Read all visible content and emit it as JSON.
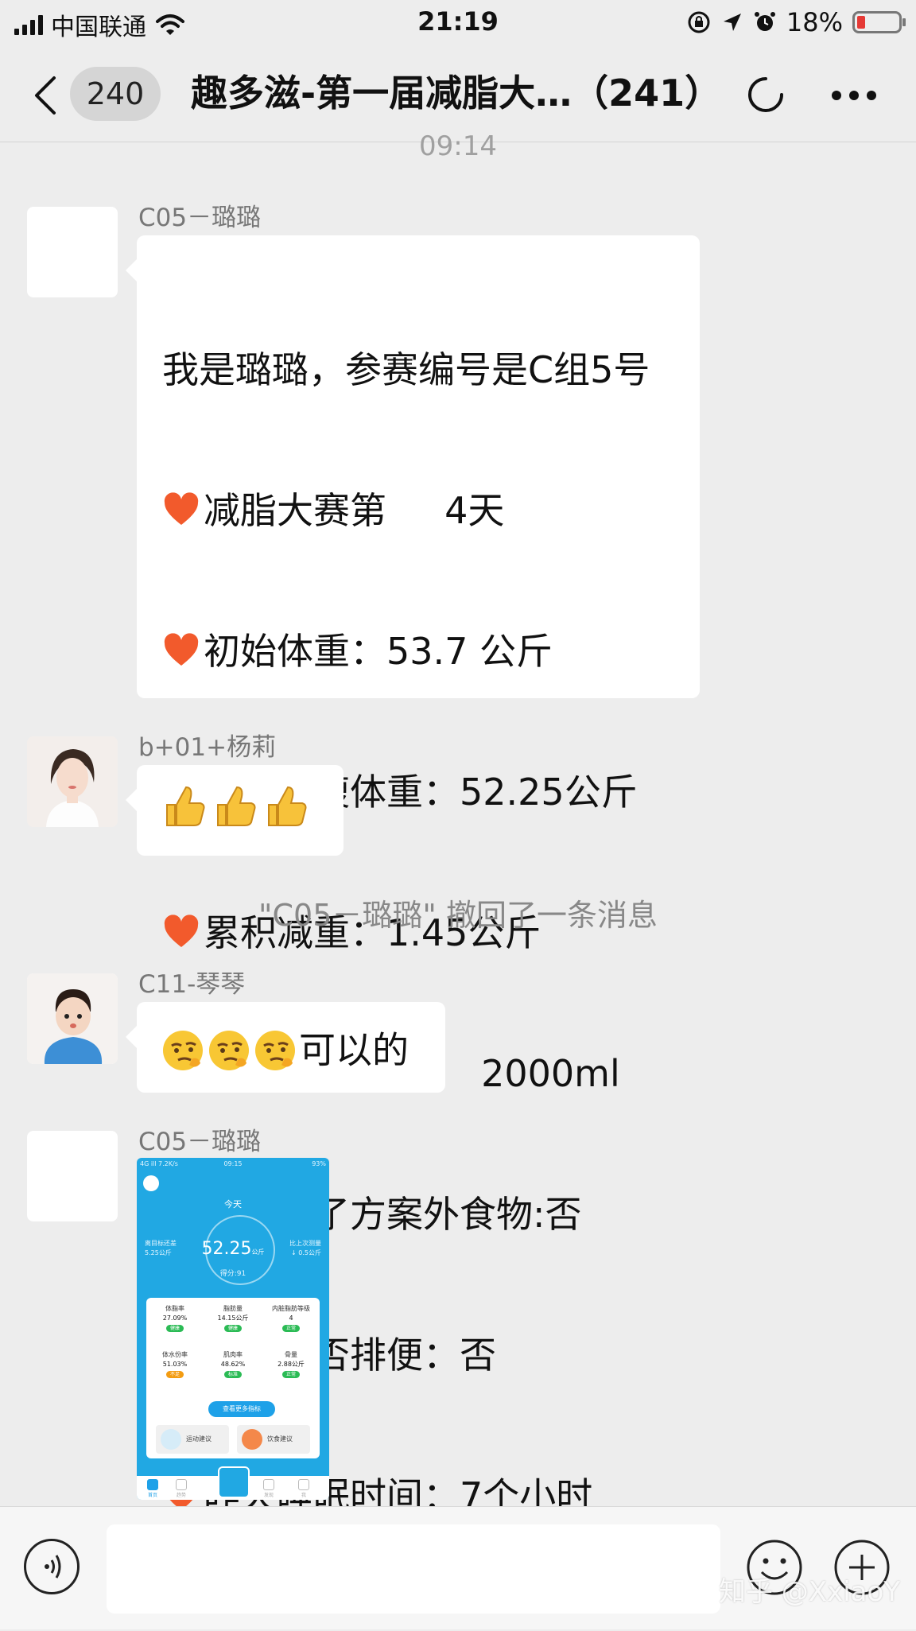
{
  "status_bar": {
    "carrier": "中国联通",
    "time": "21:19",
    "battery": "18%"
  },
  "header": {
    "back_count": "240",
    "title": "趣多滋-第一届减脂大…（241）"
  },
  "chat": {
    "timestamp": "09:14",
    "messages": [
      {
        "sender": "C05－璐璐",
        "intro": "我是璐璐，参赛编号是C组5号",
        "lines": [
          "减脂大赛第     4天",
          "初始体重：53.7 公斤",
          "今日空腹体重：52.25公斤",
          "累积减重：1.45公斤",
          "昨天饮水量：     2000ml",
          "是否吃了方案外食物:否",
          "昨天是否排便：否",
          "昨天睡眠时间：7个小时"
        ]
      },
      {
        "sender": "b+01+杨莉",
        "emoji": "thumbs-up x3"
      },
      {
        "sender": "C11-琴琴",
        "text": "可以的"
      },
      {
        "sender": "C05－璐璐"
      }
    ],
    "system_message": "\"C05－璐璐\" 撤回了一条消息"
  },
  "screenshot_image": {
    "status_left": "4G ill 7.2K/s",
    "status_time": "09:15",
    "status_right": "93%",
    "today": "今天",
    "weight": "52.25",
    "weight_unit": "公斤",
    "score": "得分:91",
    "target_label": "离目标还差",
    "target_value": "5.25公斤",
    "compare_label": "比上次测量",
    "compare_value": "↓ 0.5公斤",
    "metrics": [
      {
        "label": "体脂率",
        "value": "27.09%",
        "tag": "健康"
      },
      {
        "label": "脂肪量",
        "value": "14.15公斤",
        "tag": "健康"
      },
      {
        "label": "内脏脂肪等级",
        "value": "4",
        "tag": "正常"
      },
      {
        "label": "体水份率",
        "value": "51.03%",
        "tag": "不足"
      },
      {
        "label": "肌肉率",
        "value": "48.62%",
        "tag": "标准"
      },
      {
        "label": "骨量",
        "value": "2.88公斤",
        "tag": "正常"
      }
    ],
    "more_button": "查看更多指标",
    "advice_sport": "运动建议",
    "advice_diet": "饮食建议",
    "tabs": [
      "首页",
      "趋势",
      "",
      "发现",
      "我"
    ]
  },
  "watermark": "知乎 @XxiaoY",
  "colors": {
    "background": "#ededed",
    "bubble": "#ffffff",
    "battery_low": "#e53935",
    "app_blue": "#21a8e3"
  }
}
